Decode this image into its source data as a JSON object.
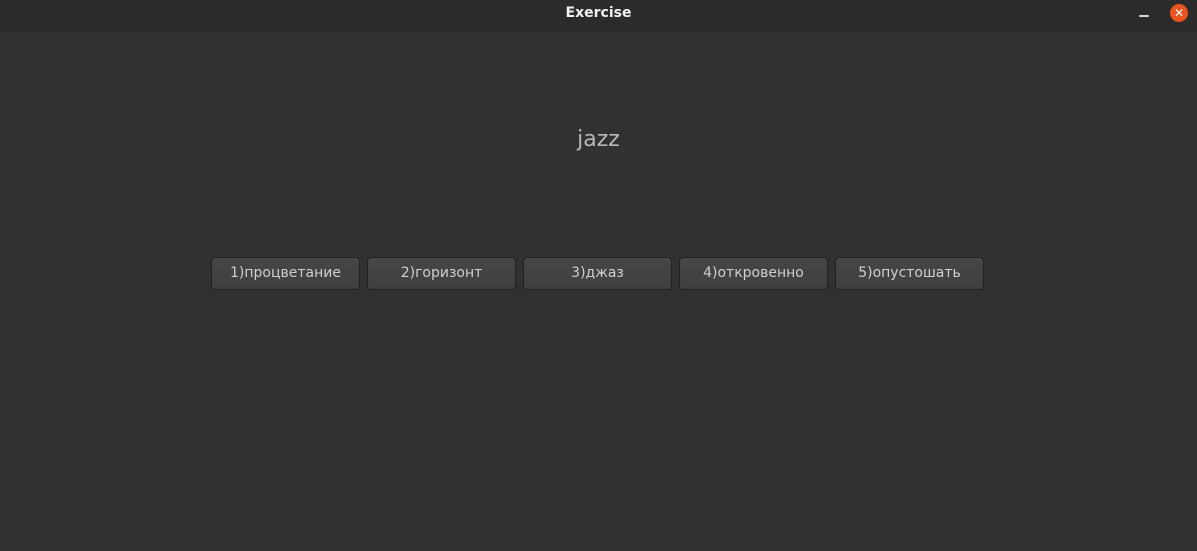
{
  "window": {
    "title": "Exercise",
    "close_icon": "✕"
  },
  "exercise": {
    "word": "jazz",
    "options": [
      "1)процветание",
      "2)горизонт",
      "3)джаз",
      "4)откровенно",
      "5)опустошать"
    ]
  },
  "colors": {
    "close_button": "#e95420",
    "background": "#313131"
  }
}
